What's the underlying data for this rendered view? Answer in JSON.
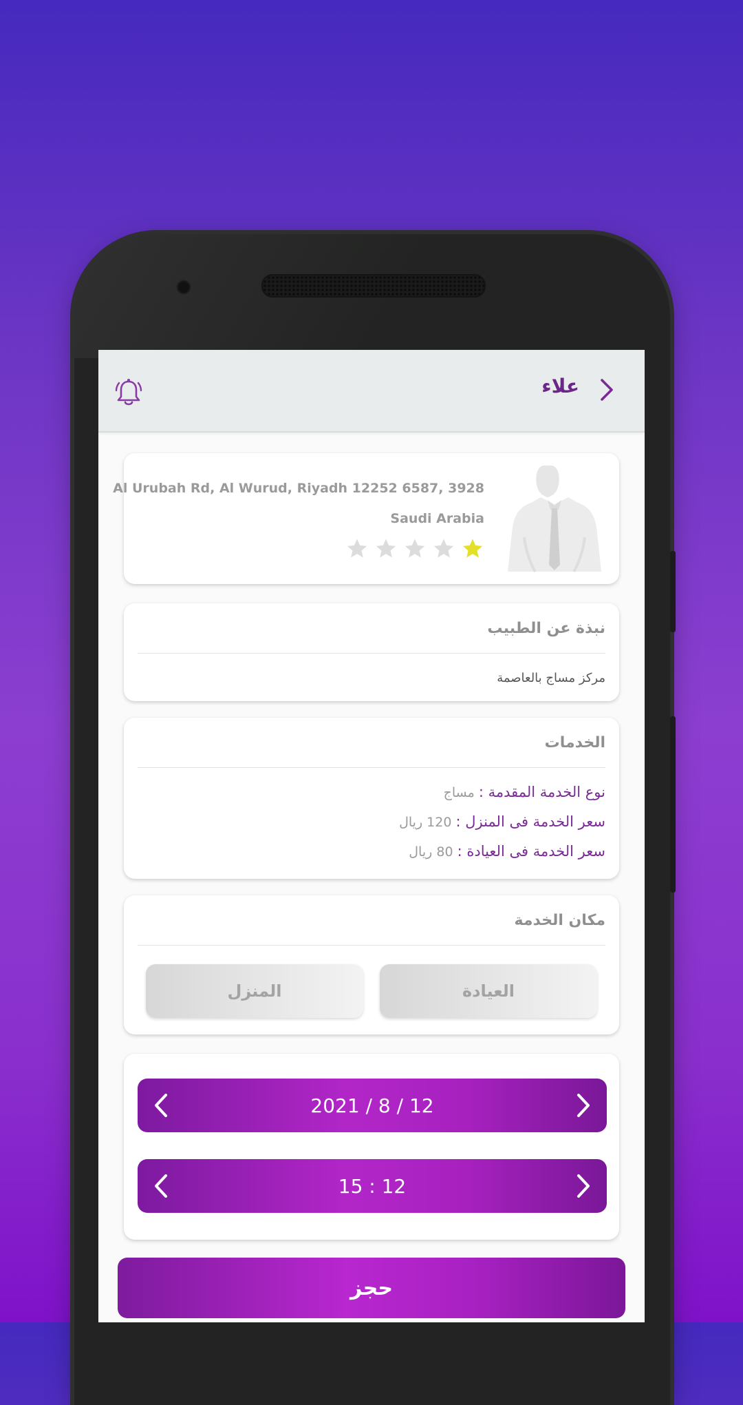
{
  "header": {
    "title": "علاء",
    "back_icon": "chevron-right-icon",
    "notification_icon": "bell-icon"
  },
  "profile": {
    "address_line1": "Al Urubah Rd, Al Wurud, Riyadh 12252 6587, 3928",
    "address_line2": "Saudi Arabia",
    "rating": {
      "value": 1,
      "max": 5,
      "filled_color": "#e4e02a",
      "empty_color": "#dcdcdc"
    },
    "avatar_icon": "person-placeholder"
  },
  "about": {
    "title": "نبذة عن الطبيب",
    "text": "مركز مساج بالعاصمة"
  },
  "services": {
    "title": "الخدمات",
    "items": [
      {
        "label": "نوع الخدمة المقدمة :",
        "value": "مساج"
      },
      {
        "label": "سعر الخدمة فى المنزل :",
        "value": "120 ريال"
      },
      {
        "label": "سعر الخدمة فى العيادة :",
        "value": "80 ريال"
      }
    ]
  },
  "service_place": {
    "title": "مكان الخدمة",
    "options": [
      "العيادة",
      "المنزل"
    ]
  },
  "schedule": {
    "date": "2021 / 8 / 12",
    "time": "15 : 12"
  },
  "book_button": "حجز",
  "colors": {
    "accent": "#7a2a95",
    "button_gradient_start": "#7d1aa0",
    "button_gradient_mid": "#b226c8"
  }
}
